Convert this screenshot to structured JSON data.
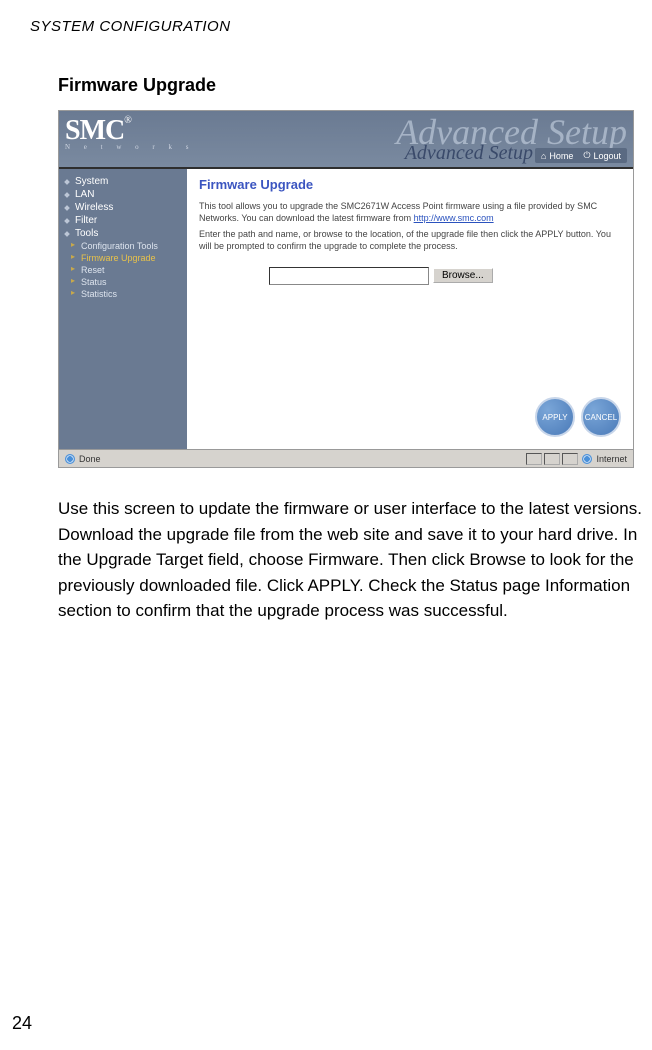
{
  "page": {
    "header": "SYSTEM CONFIGURATION",
    "section_title": "Firmware Upgrade",
    "page_number": "24",
    "body_text": "Use this screen to update the firmware or user interface to the latest versions. Download the upgrade file from the web site and save it to your hard drive. In the Upgrade Target field, choose Firmware. Then click Browse to look for the previously downloaded file. Click APPLY. Check the Status page Information section to confirm that the upgrade process was successful."
  },
  "screenshot": {
    "banner": {
      "logo_main": "SMC",
      "logo_reg": "®",
      "logo_sub": "N e t w o r k s",
      "ghost_title": "Advanced Setup",
      "overlay_title": "Advanced Setup",
      "home_link": "Home",
      "logout_link": "Logout"
    },
    "sidebar": {
      "items": [
        {
          "label": "System"
        },
        {
          "label": "LAN"
        },
        {
          "label": "Wireless"
        },
        {
          "label": "Filter"
        },
        {
          "label": "Tools"
        }
      ],
      "sub_items": [
        {
          "label": "Configuration Tools"
        },
        {
          "label": "Firmware Upgrade",
          "active": true
        },
        {
          "label": "Reset"
        },
        {
          "label": "Status"
        },
        {
          "label": "Statistics"
        }
      ]
    },
    "main": {
      "title": "Firmware Upgrade",
      "para1_a": "This tool allows you to upgrade the SMC2671W Access Point firmware using a file provided by SMC Networks. You can download the latest firmware from ",
      "para1_link": "http://www.smc.com",
      "para2": "Enter the path and name, or browse to the location, of the upgrade file then click the APPLY button. You will be prompted to confirm the upgrade to complete the process.",
      "file_input_value": "",
      "browse_label": "Browse...",
      "apply_label": "APPLY",
      "cancel_label": "CANCEL"
    },
    "status_bar": {
      "left": "Done",
      "right": "Internet"
    }
  }
}
